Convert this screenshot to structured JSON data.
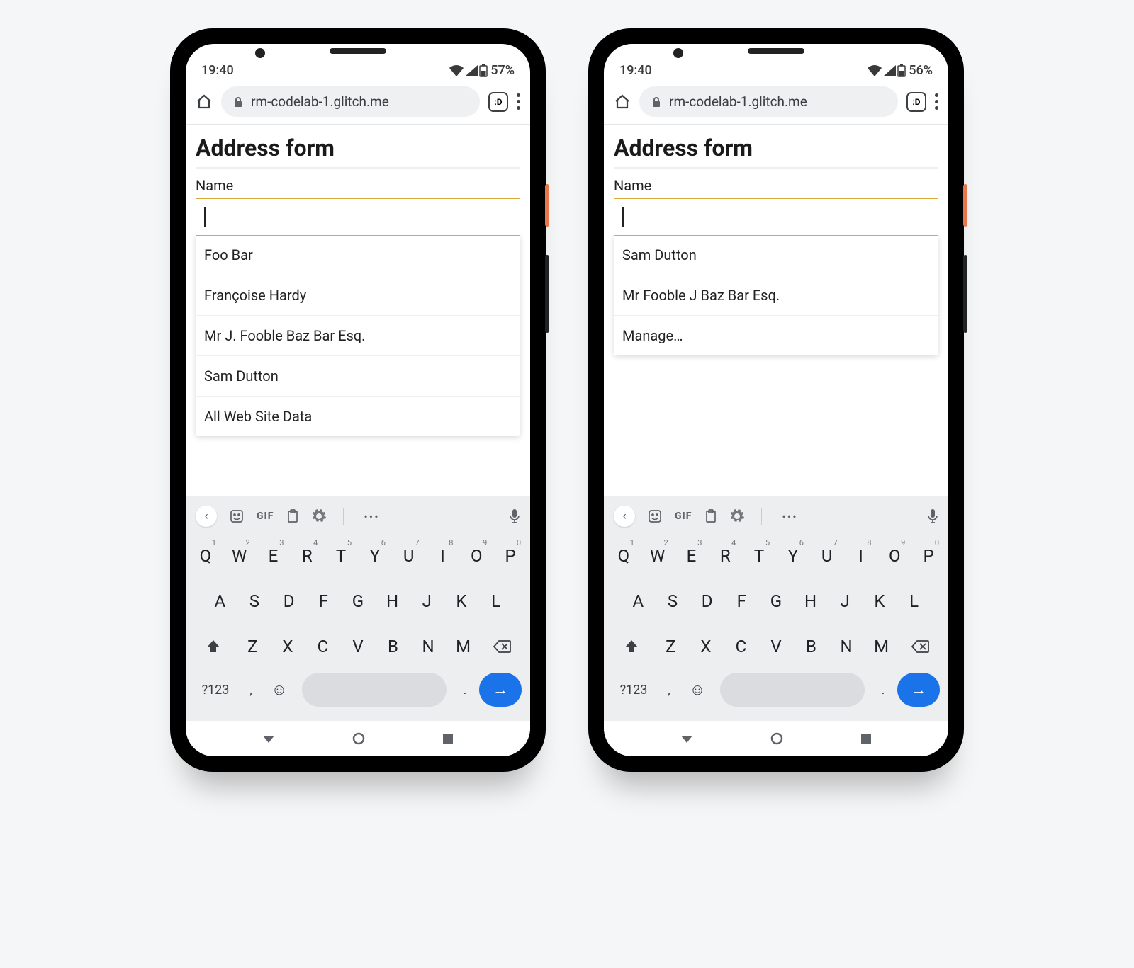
{
  "phones": [
    {
      "status": {
        "time": "19:40",
        "battery": "57%"
      },
      "browser": {
        "url": "rm-codelab-1.glitch.me",
        "tabcount": ":D"
      },
      "page": {
        "title": "Address form",
        "name_label": "Name",
        "name_value": "",
        "suggestions": [
          "Foo Bar",
          "Françoise Hardy",
          "Mr J. Fooble Baz Bar Esq.",
          "Sam Dutton",
          "All Web Site Data"
        ]
      }
    },
    {
      "status": {
        "time": "19:40",
        "battery": "56%"
      },
      "browser": {
        "url": "rm-codelab-1.glitch.me",
        "tabcount": ":D"
      },
      "page": {
        "title": "Address form",
        "name_label": "Name",
        "name_value": "",
        "suggestions": [
          "Sam Dutton",
          "Mr Fooble J Baz Bar Esq.",
          "Manage…"
        ]
      }
    }
  ],
  "keyboard": {
    "gif_label": "GIF",
    "row1": [
      {
        "k": "Q",
        "n": "1"
      },
      {
        "k": "W",
        "n": "2"
      },
      {
        "k": "E",
        "n": "3"
      },
      {
        "k": "R",
        "n": "4"
      },
      {
        "k": "T",
        "n": "5"
      },
      {
        "k": "Y",
        "n": "6"
      },
      {
        "k": "U",
        "n": "7"
      },
      {
        "k": "I",
        "n": "8"
      },
      {
        "k": "O",
        "n": "9"
      },
      {
        "k": "P",
        "n": "0"
      }
    ],
    "row2": [
      "A",
      "S",
      "D",
      "F",
      "G",
      "H",
      "J",
      "K",
      "L"
    ],
    "row3": [
      "Z",
      "X",
      "C",
      "V",
      "B",
      "N",
      "M"
    ],
    "sym_label": "?123",
    "comma": ",",
    "dot": ".",
    "enter": "→"
  }
}
